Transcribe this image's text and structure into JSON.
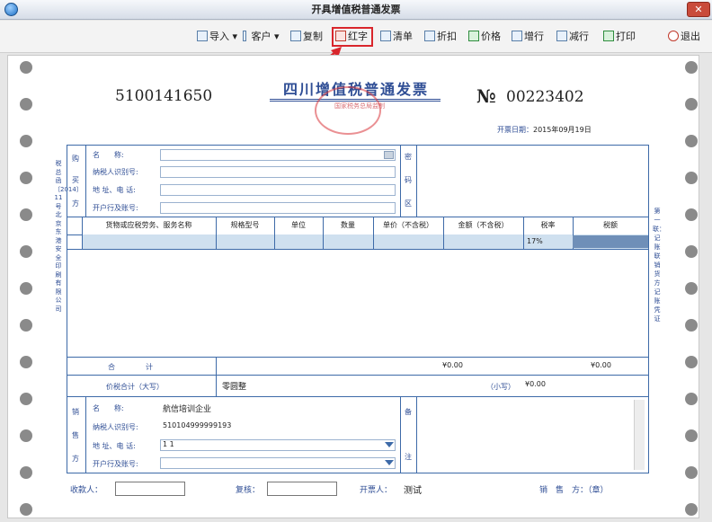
{
  "window": {
    "title": "开具增值税普通发票",
    "close_glyph": "✕"
  },
  "toolbar": [
    {
      "name": "import-button",
      "label": "导入",
      "arrow": "▾"
    },
    {
      "name": "customer-button",
      "label": "客户",
      "arrow": "▾"
    },
    {
      "name": "copy-button",
      "label": "复制"
    },
    {
      "name": "red-invoice-button",
      "label": "红字"
    },
    {
      "name": "list-button",
      "label": "清单"
    },
    {
      "name": "discount-button",
      "label": "折扣"
    },
    {
      "name": "price-button",
      "label": "价格"
    },
    {
      "name": "add-row-button",
      "label": "增行"
    },
    {
      "name": "delete-row-button",
      "label": "减行"
    },
    {
      "name": "print-button",
      "label": "打印"
    },
    {
      "name": "exit-button",
      "label": "退出"
    }
  ],
  "invoice": {
    "code": "5100141650",
    "title": "四川增值税普通发票",
    "no_sign": "№",
    "number": "00223402",
    "seal_text": "国家税务总局监制",
    "date_label": "开票日期：",
    "date_value": "2015年09月19日",
    "left_margin_text": "税总函〔2014〕11号北京东港安全印刷有限公司",
    "right_margin_text": "第一联：记账联 销货方记账凭证"
  },
  "buyer": {
    "side_label": [
      "购",
      "买",
      "方"
    ],
    "name_label": "名　　称:",
    "tax_id_label": "纳税人识别号:",
    "address_label": "地 址、电 话:",
    "bank_label": "开户行及账号:",
    "name_value": "",
    "tax_id_value": "",
    "address_value": "",
    "bank_value": ""
  },
  "password_area": {
    "label": [
      "密",
      "码",
      "区"
    ]
  },
  "table": {
    "headers": [
      "货物或应税劳务、服务名称",
      "规格型号",
      "单位",
      "数量",
      "单价（不含税）",
      "金额（不含税）",
      "税率",
      "税额"
    ],
    "rows": [
      {
        "name": "",
        "spec": "",
        "unit": "",
        "qty": "",
        "price": "",
        "amount": "",
        "rate": "17%",
        "tax": ""
      }
    ]
  },
  "totals": {
    "sum_label": "合　　计",
    "amount_total": "¥0.00",
    "tax_total": "¥0.00",
    "grand_label": "价税合计（大写）",
    "grand_upper": "零圆整",
    "small_label": "（小写）",
    "grand_lower": "¥0.00"
  },
  "seller": {
    "side_label": [
      "销",
      "售",
      "方"
    ],
    "name_label": "名　　称:",
    "tax_id_label": "纳税人识别号:",
    "address_label": "地 址、电 话:",
    "bank_label": "开户行及账号:",
    "name_value": "航信培训企业",
    "tax_id_value": "510104999999193",
    "address_value": "1 1",
    "bank_value": ""
  },
  "remarks": {
    "label": [
      "备",
      "注"
    ]
  },
  "signatures": {
    "payee_label": "收款人：",
    "reviewer_label": "复核：",
    "drawer_label": "开票人：",
    "drawer_value": "测试",
    "seller_label": "销　售　方：（章）"
  }
}
